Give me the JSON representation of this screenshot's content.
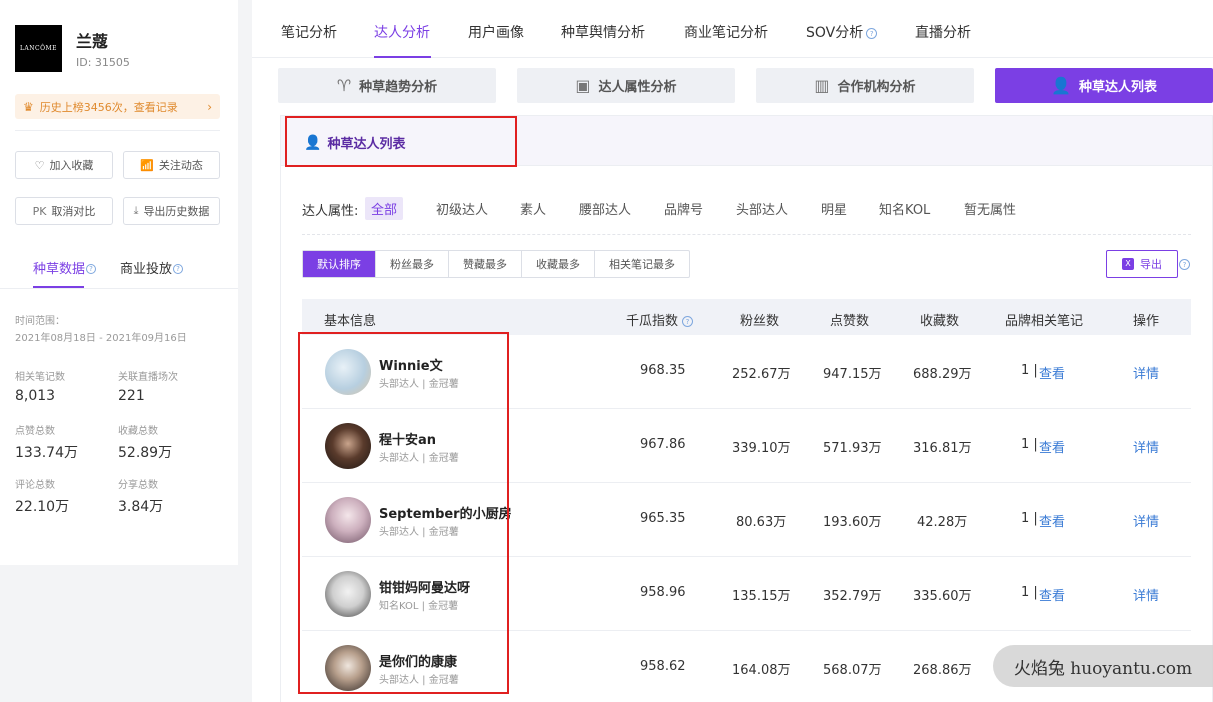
{
  "brand": {
    "logo_text": "LANCÔME",
    "name": "兰蔻",
    "id": "ID:  31505"
  },
  "sidebar": {
    "history_banner": "历史上榜3456次，查看记录",
    "buttons": {
      "favorite": "加入收藏",
      "follow": "关注动态",
      "compare": "取消对比",
      "compare_prefix": "PK",
      "export_history": "导出历史数据"
    },
    "tabs": [
      "种草数据",
      "商业投放"
    ],
    "time_range_label": "时间范围：",
    "time_range": "2021年08月18日 - 2021年09月16日",
    "stats": [
      {
        "label": "相关笔记数",
        "value": "8,013"
      },
      {
        "label": "关联直播场次",
        "value": "221"
      },
      {
        "label": "点赞总数",
        "value": "133.74万"
      },
      {
        "label": "收藏总数",
        "value": "52.89万"
      },
      {
        "label": "评论总数",
        "value": "22.10万"
      },
      {
        "label": "分享总数",
        "value": "3.84万"
      }
    ]
  },
  "topnav": {
    "items": [
      "笔记分析",
      "达人分析",
      "用户画像",
      "种草舆情分析",
      "商业笔记分析",
      "SOV分析",
      "直播分析"
    ],
    "active": "达人分析"
  },
  "subtabs": [
    "种草趋势分析",
    "达人属性分析",
    "合作机构分析",
    "种草达人列表"
  ],
  "card_title": "种草达人列表",
  "filter": {
    "label": "达人属性:",
    "options": [
      "全部",
      "初级达人",
      "素人",
      "腰部达人",
      "品牌号",
      "头部达人",
      "明星",
      "知名KOL",
      "暂无属性"
    ]
  },
  "sort_options": [
    "默认排序",
    "粉丝最多",
    "赞藏最多",
    "收藏最多",
    "相关笔记最多"
  ],
  "export_label": "导出",
  "table": {
    "headers": [
      "基本信息",
      "千瓜指数",
      "粉丝数",
      "点赞数",
      "收藏数",
      "品牌相关笔记",
      "操作"
    ],
    "rows": [
      {
        "name": "Winnie文",
        "tags": "头部达人 | 金冠薯",
        "index": "968.35",
        "fans": "252.67万",
        "likes": "947.15万",
        "collects": "688.29万",
        "notes": "1 |",
        "notes_link": "查看",
        "action": "详情"
      },
      {
        "name": "程十安an",
        "tags": "头部达人 | 金冠薯",
        "index": "967.86",
        "fans": "339.10万",
        "likes": "571.93万",
        "collects": "316.81万",
        "notes": "1 |",
        "notes_link": "查看",
        "action": "详情"
      },
      {
        "name": "September的小厨房",
        "tags": "头部达人 | 金冠薯",
        "index": "965.35",
        "fans": "80.63万",
        "likes": "193.60万",
        "collects": "42.28万",
        "notes": "1 |",
        "notes_link": "查看",
        "action": "详情"
      },
      {
        "name": "钳钳妈阿曼达呀",
        "tags": "知名KOL | 金冠薯",
        "index": "958.96",
        "fans": "135.15万",
        "likes": "352.79万",
        "collects": "335.60万",
        "notes": "1 |",
        "notes_link": "查看",
        "action": "详情"
      },
      {
        "name": "是你们的康康",
        "tags": "头部达人 | 金冠薯",
        "index": "958.62",
        "fans": "164.08万",
        "likes": "568.07万",
        "collects": "268.86万",
        "notes": "",
        "notes_link": "",
        "action": ""
      }
    ]
  },
  "watermark": "火焰兔 huoyantu.com",
  "colors": {
    "accent": "#7b3fe4",
    "link": "#3a7bd5",
    "highlight_box": "#e02020"
  }
}
